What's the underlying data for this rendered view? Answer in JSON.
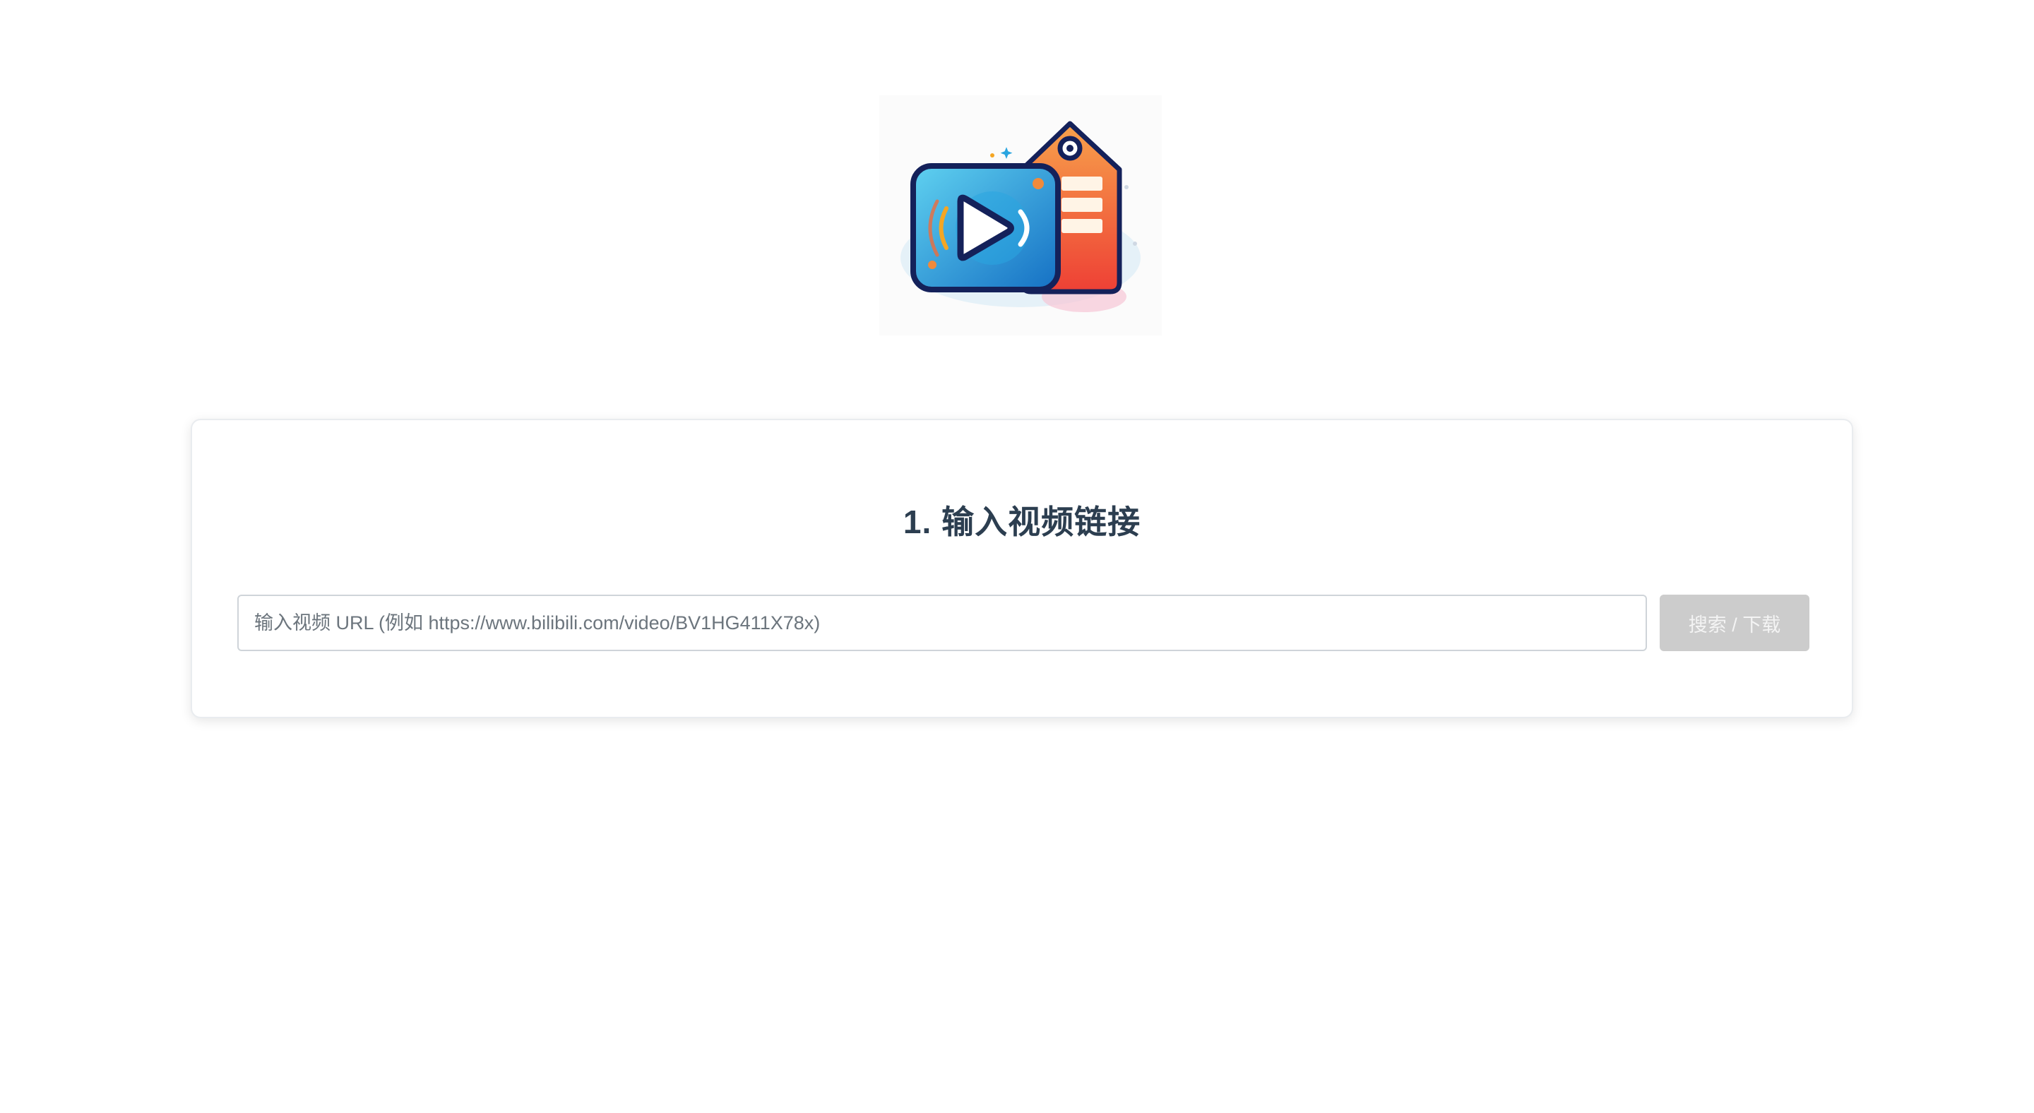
{
  "logo": {
    "icon": "video-tag-logo-icon"
  },
  "section": {
    "title": "1. 输入视频链接"
  },
  "url_input": {
    "placeholder": "输入视频 URL (例如 https://www.bilibili.com/video/BV1HG411X78x)",
    "value": ""
  },
  "search_button": {
    "label": "搜索 / 下载",
    "state": "disabled"
  },
  "colors": {
    "title": "#2c3e50",
    "button_disabled_bg": "#cccccc",
    "logo_play_blue": "#1e9ad6",
    "logo_tag_orange": "#f0553a",
    "logo_outline": "#14215a"
  }
}
